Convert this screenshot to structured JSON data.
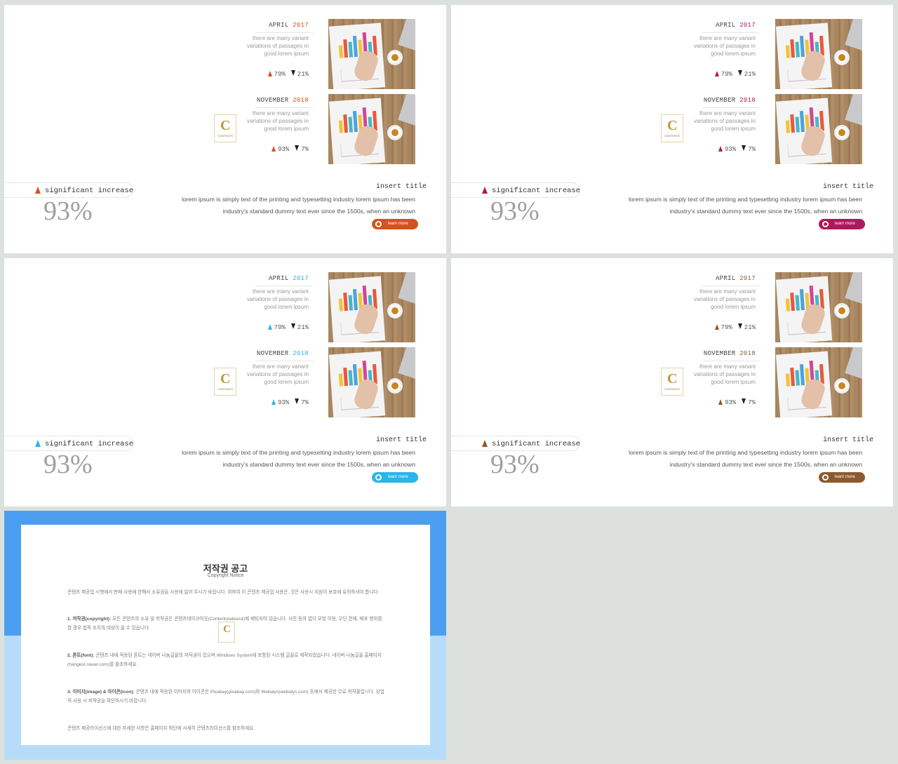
{
  "slides": [
    {
      "accent": "#d4531d",
      "block1": {
        "month": "APRIL",
        "year": "2017",
        "desc": "there are many variant variations of passages in good lorem ipsum",
        "up": "79%",
        "down": "21%"
      },
      "block2": {
        "month": "NOVEMBER",
        "year": "2018",
        "desc": "there are many variant variations of passages in good lorem ipsum",
        "up": "93%",
        "down": "7%"
      },
      "label": "significant increase",
      "percent": "93%",
      "title": "insert title",
      "body1": "lorem ipsum is simply text of the printing and typesetting industry lorem ipsum has been",
      "body2": "industry's standard dummy text ever since the 1500s, when an unknown",
      "button": "learn more"
    },
    {
      "accent": "#b0185c",
      "block1": {
        "month": "APRIL",
        "year": "2017",
        "desc": "there are many variant variations of passages in good lorem ipsum",
        "up": "79%",
        "down": "21%"
      },
      "block2": {
        "month": "NOVEMBER",
        "year": "2018",
        "desc": "there are many variant variations of passages in good lorem ipsum",
        "up": "93%",
        "down": "7%"
      },
      "label": "significant increase",
      "percent": "93%",
      "title": "insert title",
      "body1": "lorem ipsum is simply text of the printing and typesetting industry lorem ipsum has been",
      "body2": "industry's standard dummy text ever since the 1500s, when an unknown",
      "button": "learn more"
    },
    {
      "accent": "#29b6e8",
      "block1": {
        "month": "APRIL",
        "year": "2017",
        "desc": "there are many variant variations of passages in good lorem ipsum",
        "up": "79%",
        "down": "21%"
      },
      "block2": {
        "month": "NOVEMBER",
        "year": "2018",
        "desc": "there are many variant variations of passages in good lorem ipsum",
        "up": "93%",
        "down": "7%"
      },
      "label": "significant increase",
      "percent": "93%",
      "title": "insert title",
      "body1": "lorem ipsum is simply text of the printing and typesetting industry lorem ipsum has been",
      "body2": "industry's standard dummy text ever since the 1500s, when an unknown",
      "button": "learn more"
    },
    {
      "accent": "#8c5a2e",
      "block1": {
        "month": "APRIL",
        "year": "2017",
        "desc": "there are many variant variations of passages in good lorem ipsum",
        "up": "79%",
        "down": "21%"
      },
      "block2": {
        "month": "NOVEMBER",
        "year": "2018",
        "desc": "there are many variant variations of passages in good lorem ipsum",
        "up": "93%",
        "down": "7%"
      },
      "label": "significant increase",
      "percent": "93%",
      "title": "insert title",
      "body1": "lorem ipsum is simply text of the printing and typesetting industry lorem ipsum has been",
      "body2": "industry's standard dummy text ever since the 1500s, when an unknown",
      "button": "learn more"
    }
  ],
  "logo": {
    "letter": "C",
    "text": "CONTENTS"
  },
  "notice": {
    "title": "저작권 공고",
    "subtitle": "Copyright Notice",
    "p0": "콘텐츠 제공업 시행에서 판매 사용에 한해서 소유권을 사용에 일어 주시기 바랍니다. 위하여 이 콘텐츠 제공업 사용은, 것은 사용시 지원이 보호에 유의하셔야 합니다.",
    "p1_head": "1. 저작권(copyright):",
    "p1": "모든 콘텐츠의 소유 및 저작권은 콘텐츠테이크아웃(Contentstakeout)에 세팅되어 있습니다. 사전 동의 없이 모방 이용, 무단 전재, 배포 행위를 할 경우 법적 조치의 대상이 될 수 있습니다.",
    "p2_head": "2. 폰트(font):",
    "p2": "콘텐츠 내에 적용된 폰트는 네이버 나눔글꼴의 저작권이 있으며 Windows System에 포함된 시스템 글꼴로 제작되었습니다. 네이버 나눔글꼴 홈페이지(hangeul.naver.com)를 참조하세요.",
    "p3_head": "3. 이미지(image) & 아이콘(icon):",
    "p3": "콘텐츠 내에 적용된 이미지와 아이콘은 Pixabay(pixabay.com)와 Webalys(webalys.com) 등에서 제공한 무료 저작물입니다. 상업적 사용 시 저작권을 확인하시기 바랍니다.",
    "p4": "콘텐츠 제공라이선스에 대한 자세한 사항은 홈페이지 하단에 사세히 콘텐츠라이선스를 참조하세요."
  }
}
